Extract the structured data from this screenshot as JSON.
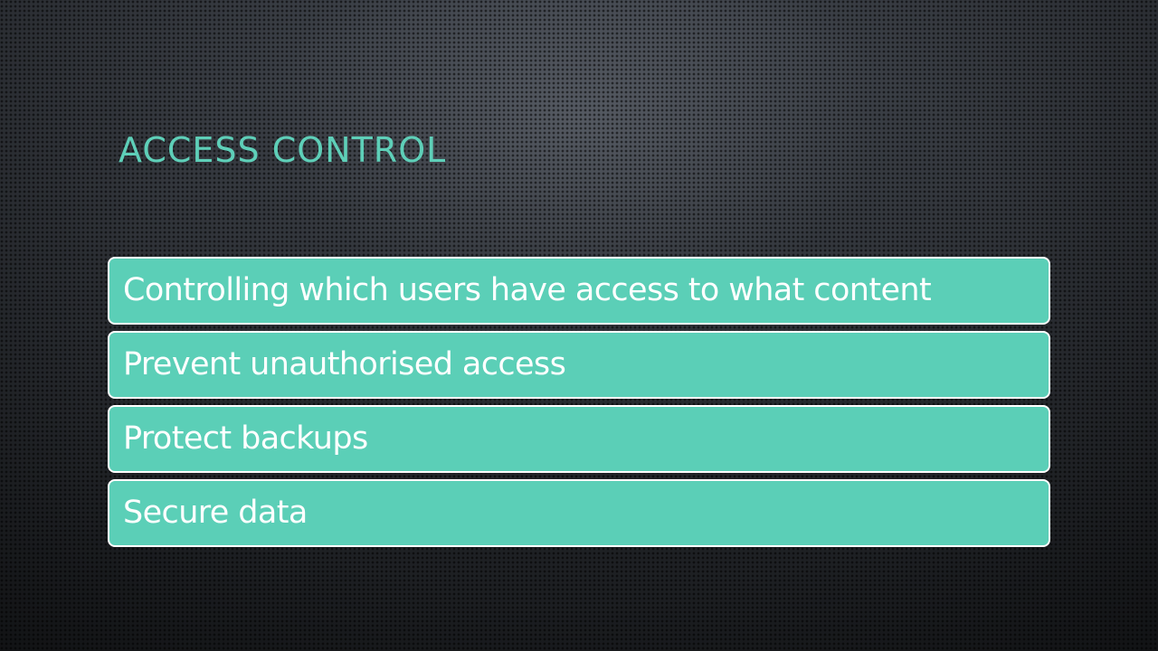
{
  "slide": {
    "title": "ACCESS CONTROL",
    "items": [
      "Controlling which users have access to what content",
      "Prevent unauthorised access",
      "Protect backups",
      "Secure data"
    ]
  },
  "colors": {
    "title": "#5ecfb8",
    "box_fill": "#5bcfb7",
    "box_border": "#ffffff",
    "box_text": "#ffffff",
    "background": "#2a2d32"
  }
}
